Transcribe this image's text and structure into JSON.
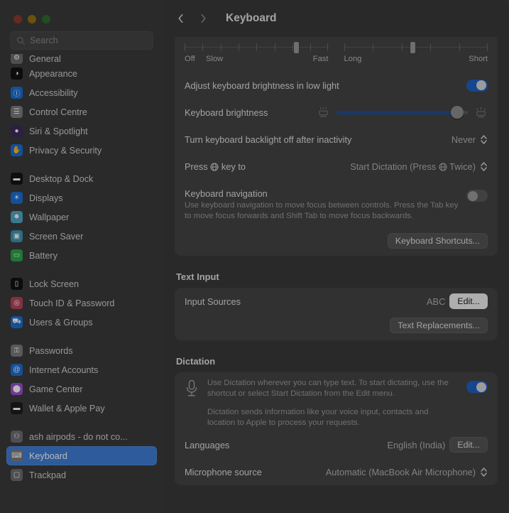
{
  "window": {
    "title": "Keyboard",
    "traffic_lights": [
      "close-button",
      "minimize-button",
      "zoom-button"
    ]
  },
  "sidebar": {
    "search": {
      "placeholder": "Search",
      "value": ""
    },
    "groups": [
      {
        "items": [
          {
            "label": "General",
            "icon": "general-icon",
            "color": "#6e6e73",
            "glyph": "⚙",
            "cut": true
          },
          {
            "label": "Appearance",
            "icon": "appearance-icon",
            "color": "#111111",
            "glyph": "◑"
          },
          {
            "label": "Accessibility",
            "icon": "accessibility-icon",
            "color": "#1b6fd6",
            "glyph": "Ⓘ"
          },
          {
            "label": "Control Centre",
            "icon": "control-centre-icon",
            "color": "#7c7c80",
            "glyph": "☰"
          },
          {
            "label": "Siri & Spotlight",
            "icon": "siri-icon",
            "color": "#3d2b5e",
            "glyph": "●"
          },
          {
            "label": "Privacy & Security",
            "icon": "privacy-icon",
            "color": "#1b6fd6",
            "glyph": "✋"
          }
        ]
      },
      {
        "items": [
          {
            "label": "Desktop & Dock",
            "icon": "desktop-dock-icon",
            "color": "#141414",
            "glyph": "▬"
          },
          {
            "label": "Displays",
            "icon": "displays-icon",
            "color": "#1b6fd6",
            "glyph": "☀"
          },
          {
            "label": "Wallpaper",
            "icon": "wallpaper-icon",
            "color": "#4fa8c8",
            "glyph": "✹"
          },
          {
            "label": "Screen Saver",
            "icon": "screen-saver-icon",
            "color": "#3f93b5",
            "glyph": "▣"
          },
          {
            "label": "Battery",
            "icon": "battery-icon",
            "color": "#2ba64a",
            "glyph": "▭"
          }
        ]
      },
      {
        "items": [
          {
            "label": "Lock Screen",
            "icon": "lock-screen-icon",
            "color": "#111111",
            "glyph": "▯"
          },
          {
            "label": "Touch ID & Password",
            "icon": "touch-id-icon",
            "color": "#b8455e",
            "glyph": "◎"
          },
          {
            "label": "Users & Groups",
            "icon": "users-groups-icon",
            "color": "#1b6fd6",
            "glyph": "⛟"
          }
        ]
      },
      {
        "items": [
          {
            "label": "Passwords",
            "icon": "passwords-icon",
            "color": "#7c7c80",
            "glyph": "⚿"
          },
          {
            "label": "Internet Accounts",
            "icon": "internet-accounts-icon",
            "color": "#1b6fd6",
            "glyph": "@"
          },
          {
            "label": "Game Center",
            "icon": "game-center-icon",
            "color": "#9b4fd0",
            "glyph": "⬤"
          },
          {
            "label": "Wallet & Apple Pay",
            "icon": "wallet-icon",
            "color": "#1c1c1c",
            "glyph": "▬"
          }
        ]
      },
      {
        "items": [
          {
            "label": "ash airpods - do not co...",
            "icon": "airpods-icon",
            "color": "#6e6e73",
            "glyph": "⚇"
          },
          {
            "label": "Keyboard",
            "icon": "keyboard-icon",
            "color": "#7c7c80",
            "glyph": "⌨",
            "selected": true
          },
          {
            "label": "Trackpad",
            "icon": "trackpad-icon",
            "color": "#6e6e73",
            "glyph": "▢"
          }
        ]
      }
    ]
  },
  "main": {
    "nav": {
      "back": "back-button",
      "forward": "forward-button"
    },
    "key_repeat_slider": {
      "labels_left": "Off",
      "labels_second": "Slow",
      "labels_right": "Fast",
      "ticks": 9,
      "knob_percent": 78
    },
    "delay_slider": {
      "labels_left": "Long",
      "labels_right": "Short",
      "ticks": 6,
      "knob_percent": 48
    },
    "adjust_brightness": {
      "label": "Adjust keyboard brightness in low light",
      "toggle": "on"
    },
    "keyboard_brightness": {
      "label": "Keyboard brightness",
      "fill_percent": 92
    },
    "backlight_off": {
      "label": "Turn keyboard backlight off after inactivity",
      "value": "Never"
    },
    "globe_key": {
      "label_before": "Press",
      "label_after": "key to",
      "value": "Start Dictation (Press ⊕ Twice)",
      "value_before": "Start Dictation (Press",
      "value_after": "Twice)"
    },
    "keyboard_navigation": {
      "title": "Keyboard navigation",
      "description": "Use keyboard navigation to move focus between controls. Press the Tab key to move focus forwards and Shift Tab to move focus backwards.",
      "toggle": "off"
    },
    "keyboard_shortcuts_button": "Keyboard Shortcuts...",
    "text_input": {
      "heading": "Text Input",
      "input_sources_label": "Input Sources",
      "input_sources_value": "ABC",
      "edit_button": "Edit...",
      "text_replacements_button": "Text Replacements..."
    },
    "dictation": {
      "heading": "Dictation",
      "paragraph_1": "Use Dictation wherever you can type text. To start dictating, use the shortcut or select Start Dictation from the Edit menu.",
      "paragraph_2": "Dictation sends information like your voice input, contacts and location to Apple to process your requests.",
      "toggle": "on",
      "languages_label": "Languages",
      "languages_value": "English (India)",
      "languages_edit_button": "Edit...",
      "microphone_label": "Microphone source",
      "microphone_value": "Automatic (MacBook Air Microphone)"
    }
  },
  "colors": {
    "accent_blue": "#1f62c4",
    "selection_blue": "#3f7fd8",
    "card_bg": "#454545",
    "window_bg": "#3a3a3a",
    "sidebar_bg": "#3b3b3b"
  }
}
